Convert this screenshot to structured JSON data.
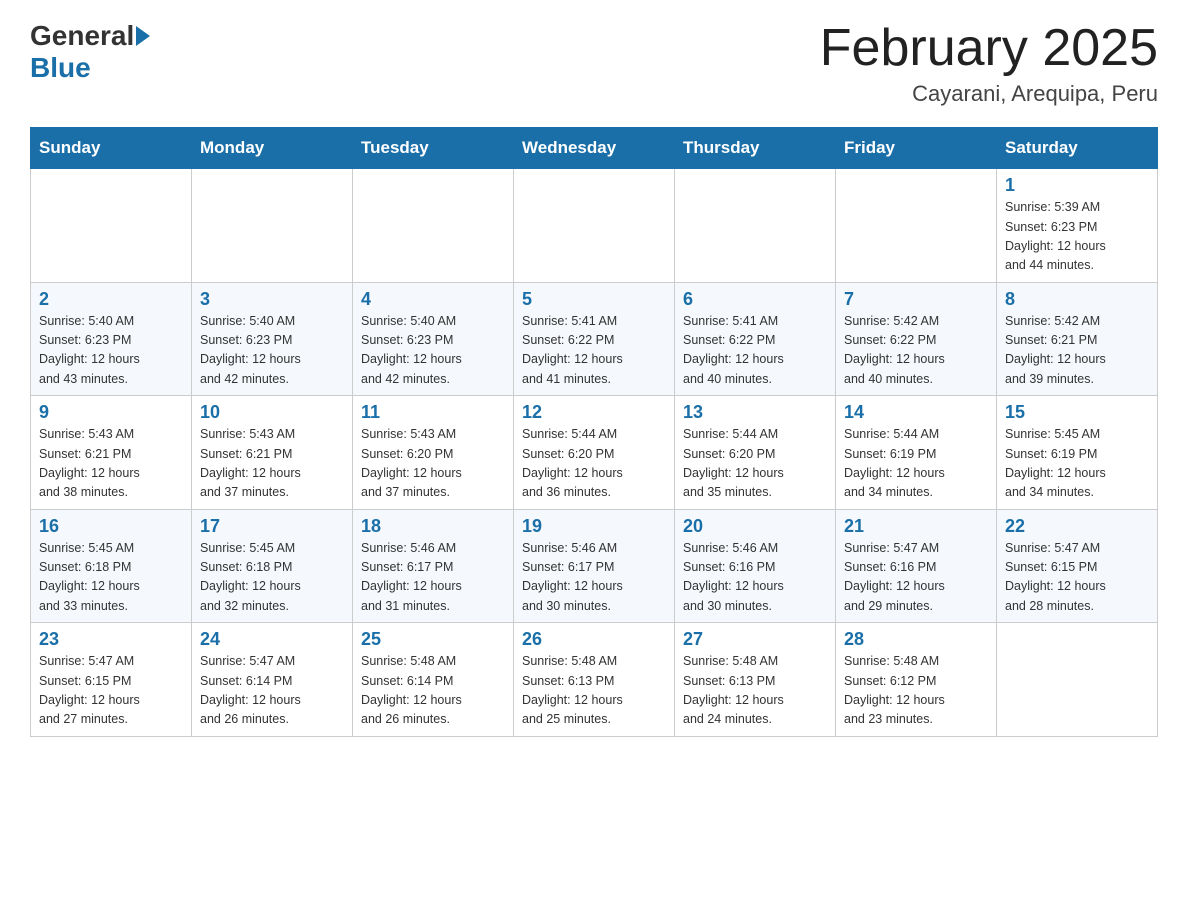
{
  "header": {
    "logo_general": "General",
    "logo_blue": "Blue",
    "month_title": "February 2025",
    "location": "Cayarani, Arequipa, Peru"
  },
  "days_of_week": [
    "Sunday",
    "Monday",
    "Tuesday",
    "Wednesday",
    "Thursday",
    "Friday",
    "Saturday"
  ],
  "weeks": [
    [
      {
        "day": "",
        "info": ""
      },
      {
        "day": "",
        "info": ""
      },
      {
        "day": "",
        "info": ""
      },
      {
        "day": "",
        "info": ""
      },
      {
        "day": "",
        "info": ""
      },
      {
        "day": "",
        "info": ""
      },
      {
        "day": "1",
        "info": "Sunrise: 5:39 AM\nSunset: 6:23 PM\nDaylight: 12 hours\nand 44 minutes."
      }
    ],
    [
      {
        "day": "2",
        "info": "Sunrise: 5:40 AM\nSunset: 6:23 PM\nDaylight: 12 hours\nand 43 minutes."
      },
      {
        "day": "3",
        "info": "Sunrise: 5:40 AM\nSunset: 6:23 PM\nDaylight: 12 hours\nand 42 minutes."
      },
      {
        "day": "4",
        "info": "Sunrise: 5:40 AM\nSunset: 6:23 PM\nDaylight: 12 hours\nand 42 minutes."
      },
      {
        "day": "5",
        "info": "Sunrise: 5:41 AM\nSunset: 6:22 PM\nDaylight: 12 hours\nand 41 minutes."
      },
      {
        "day": "6",
        "info": "Sunrise: 5:41 AM\nSunset: 6:22 PM\nDaylight: 12 hours\nand 40 minutes."
      },
      {
        "day": "7",
        "info": "Sunrise: 5:42 AM\nSunset: 6:22 PM\nDaylight: 12 hours\nand 40 minutes."
      },
      {
        "day": "8",
        "info": "Sunrise: 5:42 AM\nSunset: 6:21 PM\nDaylight: 12 hours\nand 39 minutes."
      }
    ],
    [
      {
        "day": "9",
        "info": "Sunrise: 5:43 AM\nSunset: 6:21 PM\nDaylight: 12 hours\nand 38 minutes."
      },
      {
        "day": "10",
        "info": "Sunrise: 5:43 AM\nSunset: 6:21 PM\nDaylight: 12 hours\nand 37 minutes."
      },
      {
        "day": "11",
        "info": "Sunrise: 5:43 AM\nSunset: 6:20 PM\nDaylight: 12 hours\nand 37 minutes."
      },
      {
        "day": "12",
        "info": "Sunrise: 5:44 AM\nSunset: 6:20 PM\nDaylight: 12 hours\nand 36 minutes."
      },
      {
        "day": "13",
        "info": "Sunrise: 5:44 AM\nSunset: 6:20 PM\nDaylight: 12 hours\nand 35 minutes."
      },
      {
        "day": "14",
        "info": "Sunrise: 5:44 AM\nSunset: 6:19 PM\nDaylight: 12 hours\nand 34 minutes."
      },
      {
        "day": "15",
        "info": "Sunrise: 5:45 AM\nSunset: 6:19 PM\nDaylight: 12 hours\nand 34 minutes."
      }
    ],
    [
      {
        "day": "16",
        "info": "Sunrise: 5:45 AM\nSunset: 6:18 PM\nDaylight: 12 hours\nand 33 minutes."
      },
      {
        "day": "17",
        "info": "Sunrise: 5:45 AM\nSunset: 6:18 PM\nDaylight: 12 hours\nand 32 minutes."
      },
      {
        "day": "18",
        "info": "Sunrise: 5:46 AM\nSunset: 6:17 PM\nDaylight: 12 hours\nand 31 minutes."
      },
      {
        "day": "19",
        "info": "Sunrise: 5:46 AM\nSunset: 6:17 PM\nDaylight: 12 hours\nand 30 minutes."
      },
      {
        "day": "20",
        "info": "Sunrise: 5:46 AM\nSunset: 6:16 PM\nDaylight: 12 hours\nand 30 minutes."
      },
      {
        "day": "21",
        "info": "Sunrise: 5:47 AM\nSunset: 6:16 PM\nDaylight: 12 hours\nand 29 minutes."
      },
      {
        "day": "22",
        "info": "Sunrise: 5:47 AM\nSunset: 6:15 PM\nDaylight: 12 hours\nand 28 minutes."
      }
    ],
    [
      {
        "day": "23",
        "info": "Sunrise: 5:47 AM\nSunset: 6:15 PM\nDaylight: 12 hours\nand 27 minutes."
      },
      {
        "day": "24",
        "info": "Sunrise: 5:47 AM\nSunset: 6:14 PM\nDaylight: 12 hours\nand 26 minutes."
      },
      {
        "day": "25",
        "info": "Sunrise: 5:48 AM\nSunset: 6:14 PM\nDaylight: 12 hours\nand 26 minutes."
      },
      {
        "day": "26",
        "info": "Sunrise: 5:48 AM\nSunset: 6:13 PM\nDaylight: 12 hours\nand 25 minutes."
      },
      {
        "day": "27",
        "info": "Sunrise: 5:48 AM\nSunset: 6:13 PM\nDaylight: 12 hours\nand 24 minutes."
      },
      {
        "day": "28",
        "info": "Sunrise: 5:48 AM\nSunset: 6:12 PM\nDaylight: 12 hours\nand 23 minutes."
      },
      {
        "day": "",
        "info": ""
      }
    ]
  ]
}
